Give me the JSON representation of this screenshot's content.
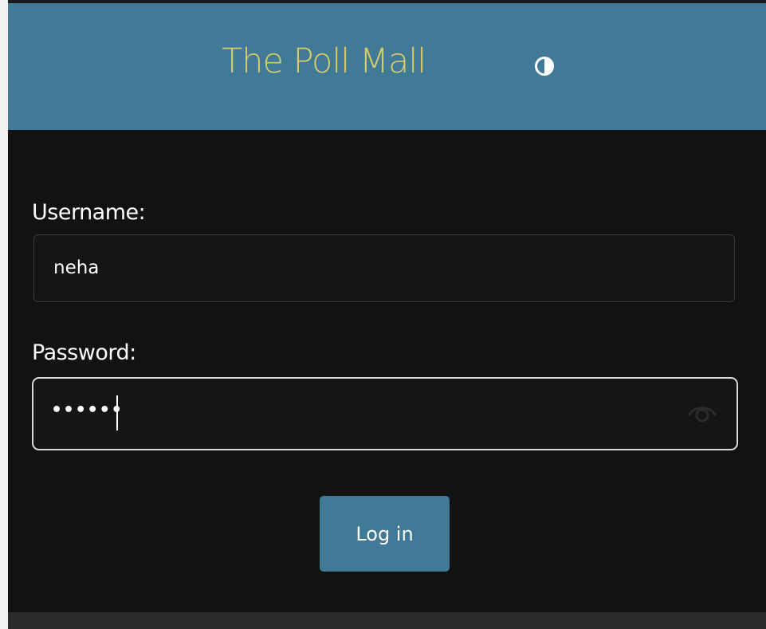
{
  "header": {
    "title": "The Poll Mall",
    "theme_toggle_icon": "contrast-icon"
  },
  "form": {
    "username": {
      "label": "Username:",
      "value": "neha"
    },
    "password": {
      "label": "Password:",
      "value_masked": "••••••",
      "visibility_icon": "eye-icon"
    },
    "login_label": "Log in"
  },
  "colors": {
    "header_bg": "#407a96",
    "title": "#d7cc6d",
    "page_bg": "#121212",
    "button_bg": "#407a96"
  }
}
